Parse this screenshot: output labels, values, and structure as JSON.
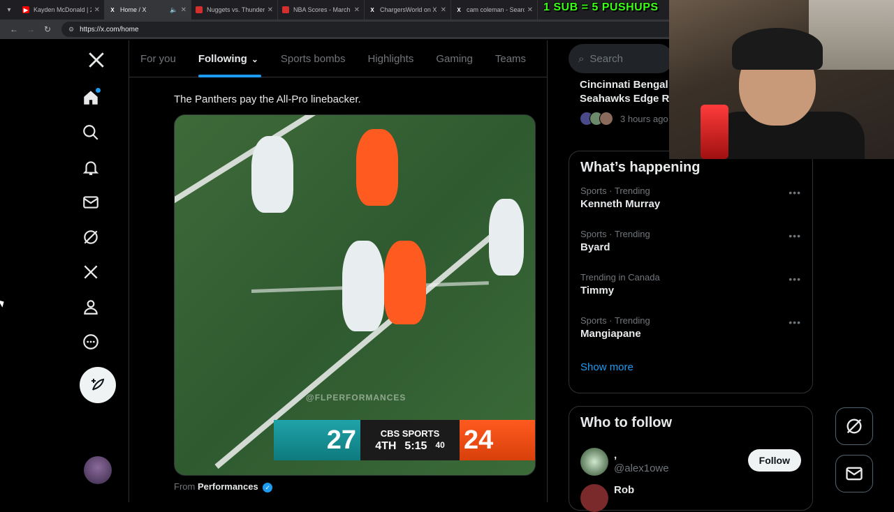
{
  "browser": {
    "tabs": [
      {
        "title": "Kayden McDonald | 2",
        "favicon": "youtube-icon",
        "color": "#ff0000",
        "active": false
      },
      {
        "title": "Home / X",
        "favicon": "x-icon",
        "color": "#ffffff",
        "active": true
      },
      {
        "title": "Nuggets vs. Thunder",
        "favicon": "red-icon",
        "color": "#d32f2f",
        "active": false
      },
      {
        "title": "NBA Scores - March",
        "favicon": "red-icon",
        "color": "#d32f2f",
        "active": false
      },
      {
        "title": "ChargersWorld on X",
        "favicon": "x-icon",
        "color": "#ffffff",
        "active": false
      },
      {
        "title": "cam coleman - Searc",
        "favicon": "x-icon",
        "color": "#ffffff",
        "active": false
      }
    ],
    "url": "https://x.com/home"
  },
  "overlay": {
    "text": "1 SUB = 5 PUSHUPS"
  },
  "feed_tabs": [
    {
      "label": "For you",
      "active": false
    },
    {
      "label": "Following",
      "active": true
    },
    {
      "label": "Sports bombs",
      "active": false
    },
    {
      "label": "Highlights",
      "active": false
    },
    {
      "label": "Gaming",
      "active": false
    },
    {
      "label": "Teams",
      "active": false
    }
  ],
  "tweet": {
    "text": "The Panthers pay the All-Pro linebacker.",
    "watermark": "@FLPERFORMANCES",
    "scorebug": {
      "team1_score": "27",
      "network": "CBS SPORTS",
      "quarter": "4TH",
      "clock": "5:15",
      "play_clock": "40",
      "team2_score": "24"
    },
    "from_prefix": "From",
    "from_name": "Performances"
  },
  "search": {
    "placeholder": "Search"
  },
  "news": {
    "title_line1": "Cincinnati Bengal",
    "title_line2": "Seahawks Edge Re",
    "time": "3 hours ago"
  },
  "whats_happening": {
    "title": "What’s happening",
    "trends": [
      {
        "category": "Sports · Trending",
        "name": "Kenneth Murray"
      },
      {
        "category": "Sports · Trending",
        "name": "Byard"
      },
      {
        "category": "Trending in Canada",
        "name": "Timmy"
      },
      {
        "category": "Sports · Trending",
        "name": "Mangiapane"
      }
    ],
    "show_more": "Show more"
  },
  "who_to_follow": {
    "title": "Who to follow",
    "users": [
      {
        "name": ",",
        "handle": "@alex1owe",
        "button": "Follow"
      },
      {
        "name": "Rob",
        "handle": "",
        "button": ""
      }
    ]
  }
}
